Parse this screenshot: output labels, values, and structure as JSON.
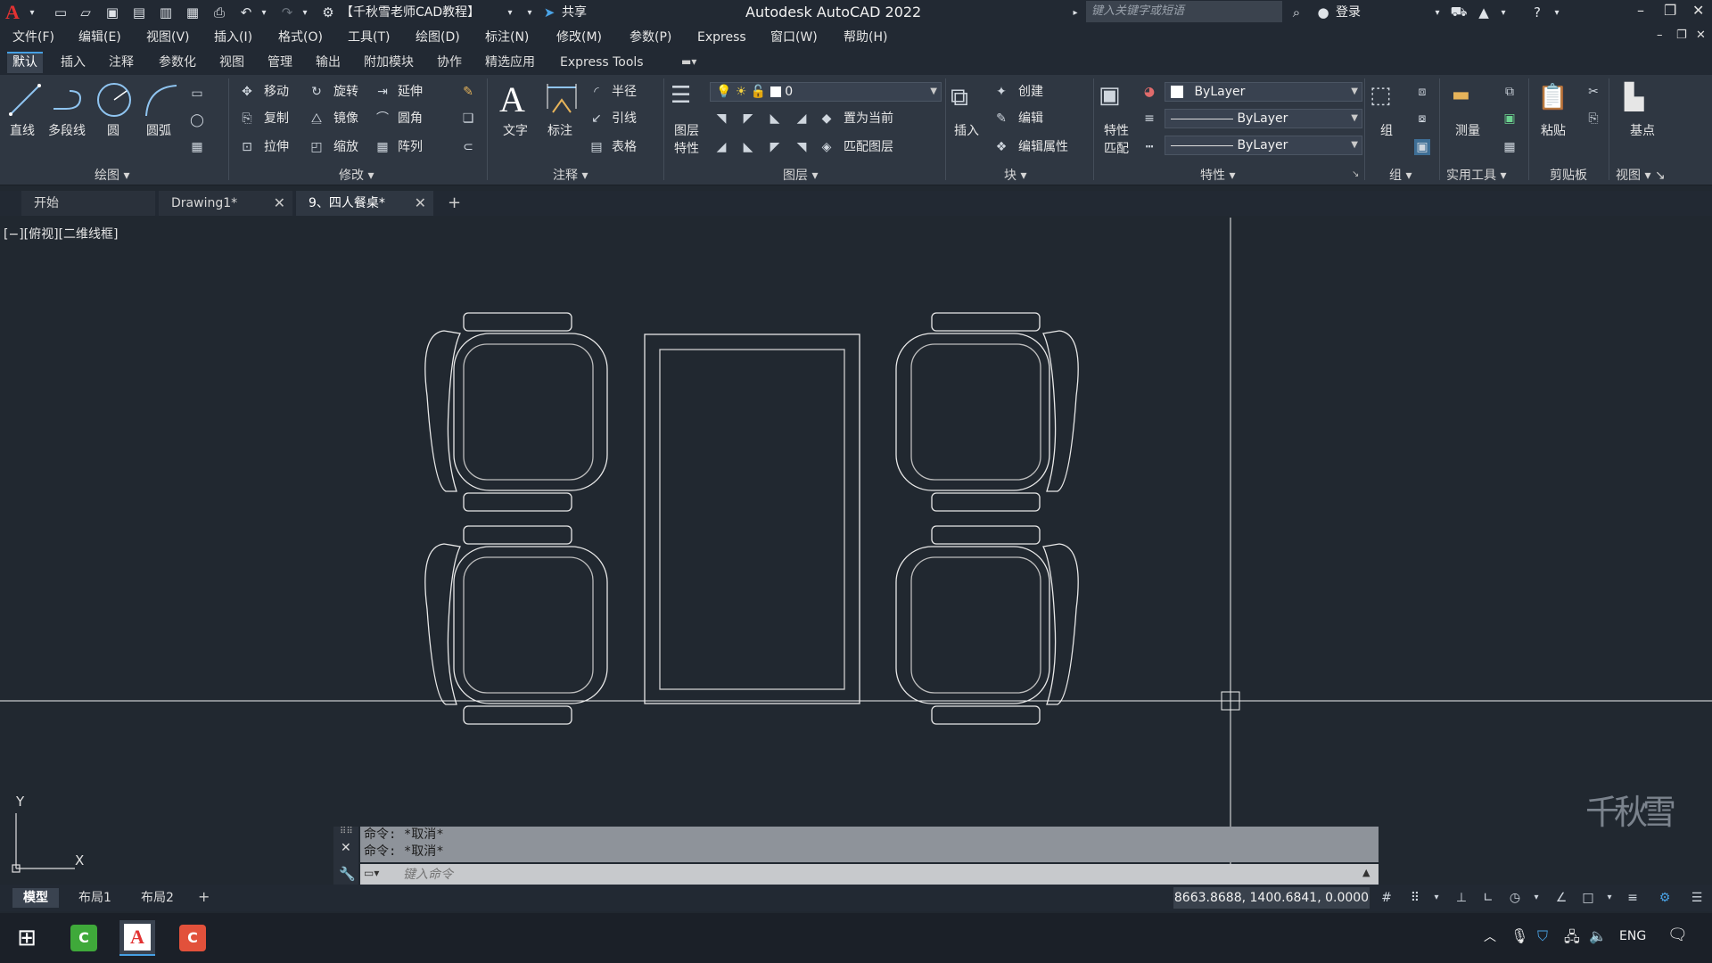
{
  "titlebar": {
    "app_logo": "A",
    "workspace": "【千秋雪老师CAD教程】",
    "share": "共享",
    "title": "Autodesk AutoCAD 2022",
    "search_placeholder": "键入关键字或短语",
    "login": "登录"
  },
  "menubar": [
    "文件(F)",
    "编辑(E)",
    "视图(V)",
    "插入(I)",
    "格式(O)",
    "工具(T)",
    "绘图(D)",
    "标注(N)",
    "修改(M)",
    "参数(P)",
    "Express",
    "窗口(W)",
    "帮助(H)"
  ],
  "ribbon_tabs": [
    "默认",
    "插入",
    "注释",
    "参数化",
    "视图",
    "管理",
    "输出",
    "附加模块",
    "协作",
    "精选应用",
    "Express Tools"
  ],
  "ribbon": {
    "draw": {
      "title": "绘图",
      "line": "直线",
      "polyline": "多段线",
      "circle": "圆",
      "arc": "圆弧"
    },
    "modify": {
      "title": "修改",
      "move": "移动",
      "rotate": "旋转",
      "extend": "延伸",
      "copy": "复制",
      "mirror": "镜像",
      "fillet": "圆角",
      "stretch": "拉伸",
      "scale": "缩放",
      "array": "阵列"
    },
    "annotation": {
      "title": "注释",
      "text": "文字",
      "dimension": "标注",
      "radius": "半径",
      "leader": "引线",
      "table": "表格"
    },
    "layers": {
      "title": "图层",
      "layer_props": "图层特性",
      "layer_props_l1": "图层",
      "layer_props_l2": "特性",
      "current_layer": "0",
      "set_current": "置为当前",
      "match_layer": "匹配图层"
    },
    "block": {
      "title": "块",
      "insert": "插入",
      "create": "创建",
      "edit": "编辑",
      "edit_attr": "编辑属性"
    },
    "properties": {
      "title": "特性",
      "match_l1": "特性",
      "match_l2": "匹配",
      "color": "ByLayer",
      "linetype": "ByLayer",
      "lineweight": "ByLayer"
    },
    "groups": {
      "title": "组",
      "group": "组"
    },
    "utilities": {
      "title": "实用工具",
      "measure": "测量"
    },
    "clipboard": {
      "title": "剪贴板",
      "paste": "粘贴"
    },
    "view": {
      "title": "视图",
      "base": "基点"
    }
  },
  "doc_tabs": [
    {
      "label": "开始"
    },
    {
      "label": "Drawing1*"
    },
    {
      "label": "9、四人餐桌*"
    }
  ],
  "viewport_label": "[−][俯视][二维线框]",
  "ucs": {
    "x": "X",
    "y": "Y"
  },
  "command": {
    "history": [
      "命令: *取消*",
      "命令: *取消*"
    ],
    "placeholder": "键入命令"
  },
  "layout_tabs": [
    "模型",
    "布局1",
    "布局2"
  ],
  "status": {
    "coords": "8663.8688, 1400.6841, 0.0000"
  },
  "taskbar": {
    "lang": "ENG"
  },
  "watermark": "千秋雪",
  "colors": {
    "accent": "#46a0e4",
    "canvas": "#212830",
    "autocad_red": "#e23232"
  }
}
